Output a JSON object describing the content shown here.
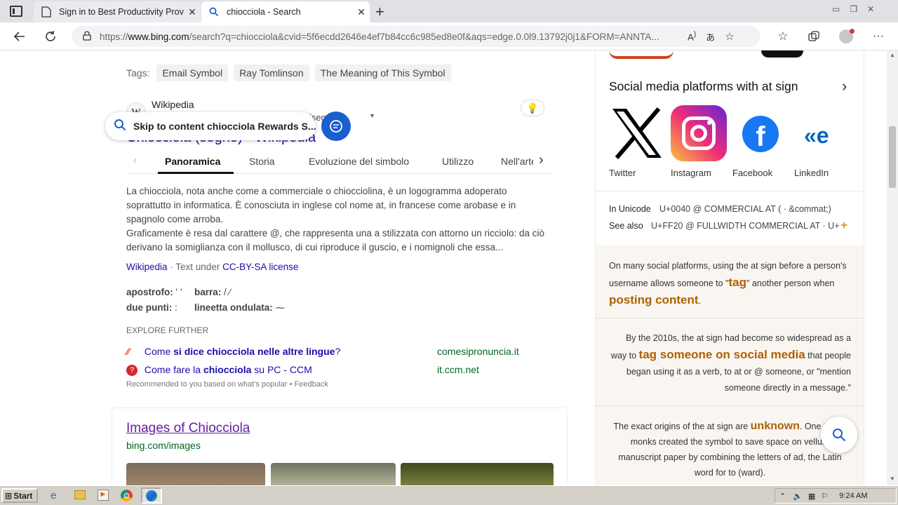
{
  "browser": {
    "tabs": [
      {
        "title": "Sign in to Best Productivity Provi"
      },
      {
        "title": "chiocciola - Search"
      }
    ],
    "url_prefix": "https://",
    "url_domain": "www.bing.com",
    "url_rest": "/search?q=chiocciola&cvid=5f6ecdd2646e4ef7b84cc6c985ed8e0f&aqs=edge.0.0l9.13792j0j1&FORM=ANNTA..."
  },
  "tags": {
    "label": "Tags:",
    "items": [
      "Email Symbol",
      "Ray Tomlinson",
      "The Meaning of This Symbol"
    ]
  },
  "wiki": {
    "source": "Wikipedia",
    "subtitle_tail": "ciol(segno)",
    "title": "Chiocciola (segno) - Wikipedia",
    "skip_banner": "Skip to content chiocciola Rewards S...",
    "tabs": [
      "Panoramica",
      "Storia",
      "Evoluzione del simbolo",
      "Utilizzo",
      "Nell'arte"
    ],
    "para1": "La chiocciola, nota anche come a commerciale o chiocciolina, è un logogramma adoperato soprattutto in informatica. È conosciuta in inglese col nome at, in francese come arobase e in spagnolo come arroba.",
    "para2": "Graficamente è resa dal carattere @, che rappresenta una a stilizzata con attorno un ricciolo: da ciò derivano la somiglianza con il mollusco, di cui riproduce il guscio, e i nomignoli che essa...",
    "attrib_source": "Wikipedia",
    "attrib_mid": " · Text under ",
    "attrib_license": "CC-BY-SA license",
    "facts": [
      {
        "k": "apostrofo:",
        "v": "' '"
      },
      {
        "k": "barra:",
        "v": "/ ⁄"
      },
      {
        "k": "due punti:",
        "v": ":"
      },
      {
        "k": "lineetta ondulata:",
        "v": "⁓"
      }
    ]
  },
  "explore": {
    "heading": "EXPLORE FURTHER",
    "items": [
      {
        "text_pre": "Come ",
        "text_bold": "si dice chiocciola nelle altre lingue",
        "text_post": "?",
        "domain": "comesipronuncia.it"
      },
      {
        "text_pre": "Come fare la ",
        "text_bold": "chiocciola",
        "text_post": " su PC - CCM",
        "domain": "it.ccm.net"
      }
    ],
    "footer": "Recommended to you based on what's popular • Feedback"
  },
  "images": {
    "title": "Images of Chiocciola",
    "domain": "bing.com/images"
  },
  "sidebar": {
    "social_heading": "Social media platforms with at sign",
    "socials": [
      "Twitter",
      "Instagram",
      "Facebook",
      "LinkedIn"
    ],
    "unicode_label": "In Unicode",
    "unicode_value": "U+0040 @ COMMERCIAL AT ( · &commat;)",
    "seealso_label": "See also",
    "seealso_value": "U+FF20 @ FULLWIDTH COMMERCIAL AT · U+...",
    "card1_a": "On many social platforms, using the at sign before a person's username allows someone to \"",
    "card1_b": "tag",
    "card1_c": "\" another person when ",
    "card1_d": "posting content",
    "card1_e": ".",
    "card2_a": "By the 2010s, the at sign had become so widespread as a way to ",
    "card2_b": "tag someone on social media",
    "card2_c": " that people began using it as a verb, to at or @ someone, or \"mention someone directly in a message.\"",
    "card3_a": "The exact origins of the at sign are ",
    "card3_b": "unknown",
    "card3_c": ". One thinks monks created the symbol to save space on vellum manuscript paper by combining the letters of ad, the Latin word for to (ward)."
  },
  "taskbar": {
    "start": "Start",
    "time": "9:24 AM"
  },
  "colors": {
    "accent_blue": "#1a5fd0",
    "link": "#1a0dab",
    "visited": "#681da8",
    "domain_green": "#006621",
    "orange": "#b06000"
  }
}
